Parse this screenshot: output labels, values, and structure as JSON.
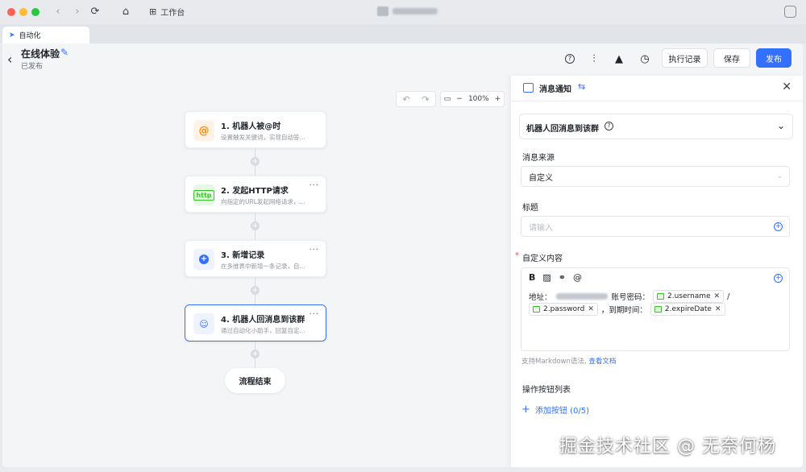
{
  "window": {
    "workbench_label": "工作台"
  },
  "tab": {
    "label": "自动化"
  },
  "header": {
    "title": "在线体验",
    "status": "已发布",
    "buttons": {
      "run_log": "执行记录",
      "save": "保存",
      "publish": "发布"
    }
  },
  "canvas": {
    "zoom": "100%",
    "nodes": [
      {
        "title": "1. 机器人被@时",
        "desc": "设置触发关键词，实现自动答...",
        "icon": "at-icon"
      },
      {
        "title": "2. 发起HTTP请求",
        "desc": "向指定的URL发起网络请求，...",
        "icon": "http-icon"
      },
      {
        "title": "3. 新增记录",
        "desc": "在多维表中新增一条记录，自...",
        "icon": "add-record-icon"
      },
      {
        "title": "4. 机器人回消息到该群",
        "desc": "通过自动化小助手，回复自定...",
        "icon": "bot-message-icon"
      }
    ],
    "end_label": "流程结束"
  },
  "panel": {
    "title": "消息通知",
    "section_title": "机器人回消息到该群",
    "source_label": "消息来源",
    "source_value": "自定义",
    "heading_label": "标题",
    "heading_placeholder": "请输入",
    "content_label": "自定义内容",
    "content": {
      "address_prefix": "地址：",
      "account_label": "账号密码：",
      "chip_username": "2.username",
      "separator": "/",
      "chip_password": "2.password",
      "expire_label": "，到期时间：",
      "chip_expire": "2.expireDate"
    },
    "hint_text": "支持Markdown语法,",
    "hint_link": "查看文档",
    "actions_label": "操作按钮列表",
    "add_button_label": "添加按钮 (0/5)"
  },
  "watermark": "掘金技术社区 @ 无奈何杨",
  "colors": {
    "accent": "#3370ff",
    "danger": "#f54a45",
    "field_green": "#34c724"
  }
}
